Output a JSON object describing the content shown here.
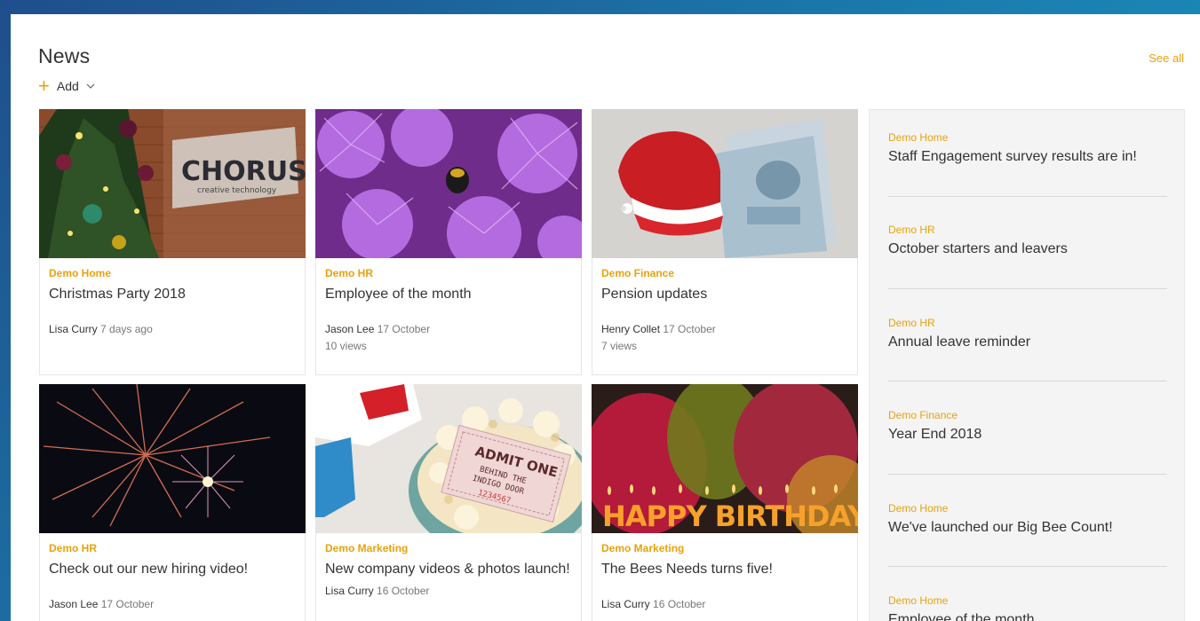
{
  "header": {
    "title": "News",
    "see_all": "See all",
    "add_label": "Add"
  },
  "cards": [
    {
      "site": "Demo Home",
      "title": "Christmas Party 2018",
      "author": "Lisa Curry",
      "date": "7 days ago",
      "views": ""
    },
    {
      "site": "Demo HR",
      "title": "Employee of the month",
      "author": "Jason Lee",
      "date": "17 October",
      "views": "10 views"
    },
    {
      "site": "Demo Finance",
      "title": "Pension updates",
      "author": "Henry Collet",
      "date": "17 October",
      "views": "7 views"
    },
    {
      "site": "Demo HR",
      "title": "Check out our new hiring video!",
      "author": "Jason Lee",
      "date": "17 October",
      "views": ""
    },
    {
      "site": "Demo Marketing",
      "title": "New company videos & photos launch!",
      "author": "Lisa Curry",
      "date": "16 October",
      "views": ""
    },
    {
      "site": "Demo Marketing",
      "title": "The Bees Needs turns five!",
      "author": "Lisa Curry",
      "date": "16 October",
      "views": ""
    }
  ],
  "images": {
    "chorus_sign": "CHORUS",
    "chorus_sub": "creative technology",
    "ticket_line1": "ADMIT ONE",
    "ticket_line2": "BEHIND THE",
    "ticket_line3": "INDIGO DOOR",
    "ticket_number": "1234567",
    "birthday_text": "HAPPY BIRTHDAY"
  },
  "sidebar": {
    "items": [
      {
        "site": "Demo Home",
        "title": "Staff Engagement survey results are in!"
      },
      {
        "site": "Demo HR",
        "title": "October starters and leavers"
      },
      {
        "site": "Demo HR",
        "title": "Annual leave reminder"
      },
      {
        "site": "Demo Finance",
        "title": "Year End 2018"
      },
      {
        "site": "Demo Home",
        "title": "We've launched our Big Bee Count!"
      },
      {
        "site": "Demo Home",
        "title": "Employee of the month"
      }
    ]
  },
  "colors": {
    "accent": "#e8a20d",
    "background_gradient_start": "#1f4e8c",
    "background_gradient_end": "#1a9ac2"
  }
}
